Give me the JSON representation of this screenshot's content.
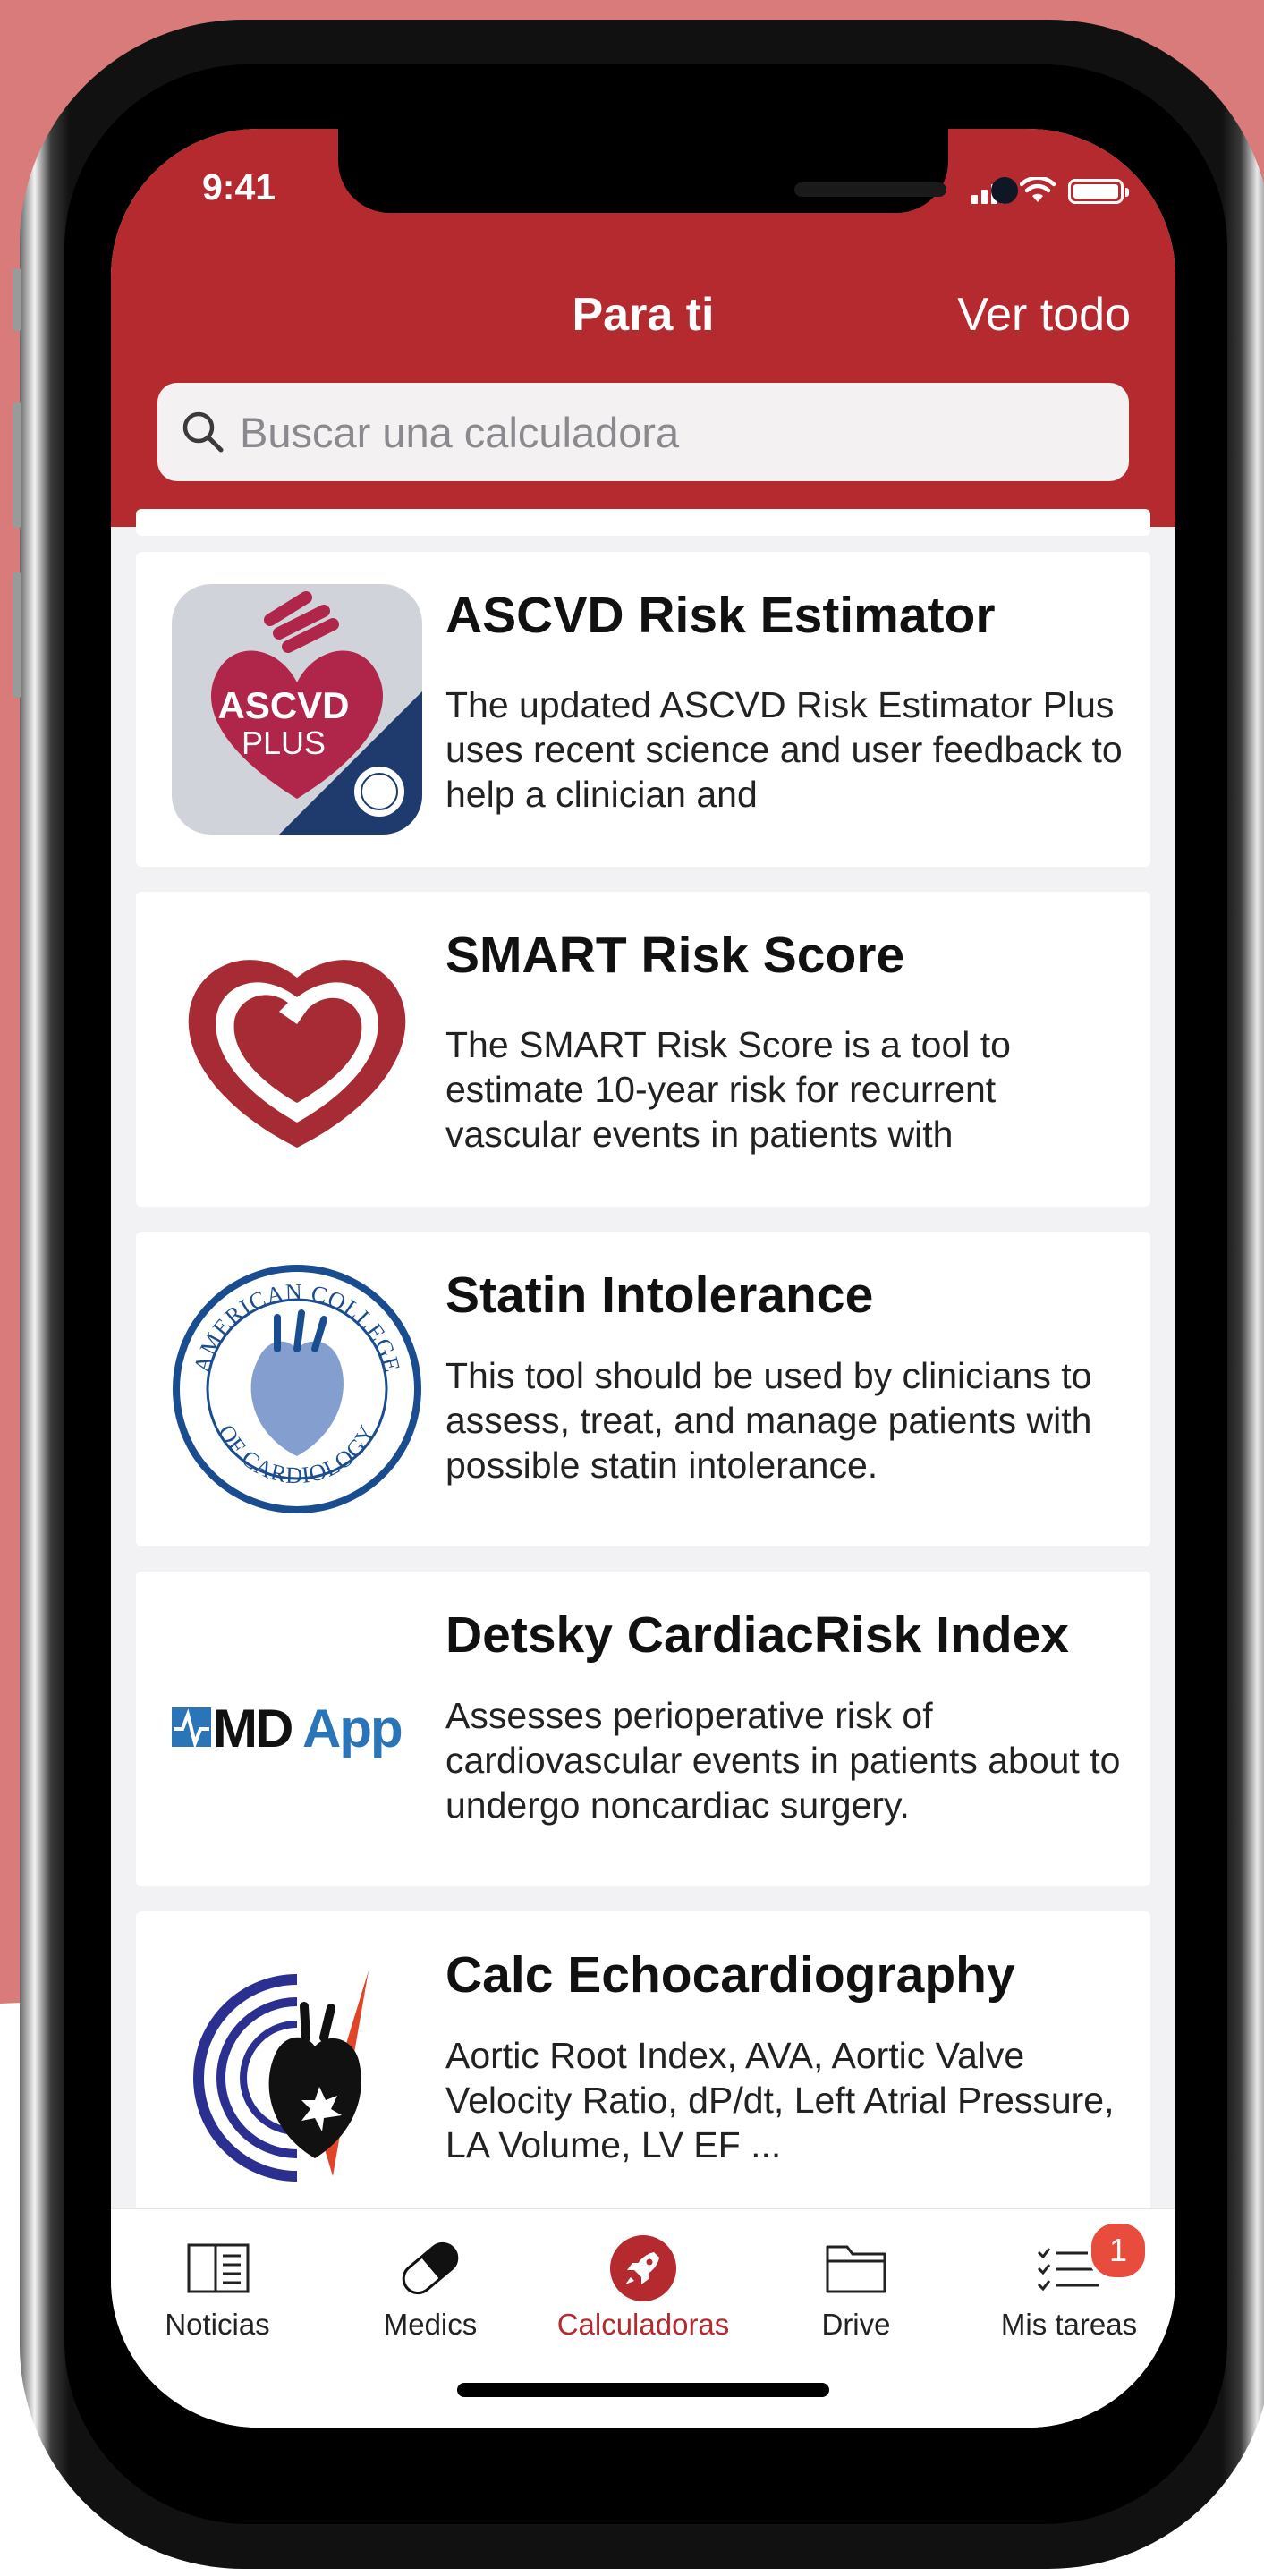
{
  "status_bar": {
    "time": "9:41"
  },
  "header": {
    "title": "Para ti",
    "action": "Ver todo"
  },
  "search": {
    "placeholder": "Buscar una calculadora"
  },
  "cards": [
    {
      "title": "ASCVD Risk Estimator",
      "description": "The updated ASCVD Risk Estimator Plus uses recent science and user feedback to help a clinician and",
      "icon": "ascvd-plus-logo",
      "icon_text": [
        "ASCVD",
        "PLUS"
      ]
    },
    {
      "title": "SMART Risk Score",
      "description": "The SMART Risk Score is a tool to estimate 10-year risk for recurrent vascular events in patients with",
      "icon": "heart-logo"
    },
    {
      "title": "Statin Intolerance",
      "description": "This tool should be used by clinicians to assess, treat, and manage patients with possible statin intolerance.",
      "icon": "acc-seal-logo",
      "icon_text": [
        "AMERICAN COLLEGE",
        "OF CARDIOLOGY"
      ]
    },
    {
      "title": "Detsky CardiacRisk Index",
      "description": "Assesses perioperative risk of cardiovascular events in patients about to undergo noncardiac surgery.",
      "icon": "mdapp-logo",
      "icon_text": [
        "MD",
        "App"
      ]
    },
    {
      "title": "Calc Echocardiography",
      "description": "Aortic Root Index, AVA, Aortic Valve Velocity Ratio, dP/dt, Left Atrial Pressure, LA Volume, LV EF ...",
      "icon": "echo-heart-logo"
    }
  ],
  "tabs": [
    {
      "label": "Noticias",
      "icon": "newspaper-icon"
    },
    {
      "label": "Medics",
      "icon": "pill-icon"
    },
    {
      "label": "Calculadoras",
      "icon": "rocket-icon",
      "active": true
    },
    {
      "label": "Drive",
      "icon": "folder-icon"
    },
    {
      "label": "Mis tareas",
      "icon": "checklist-icon",
      "badge": "1"
    }
  ],
  "colors": {
    "brand": "#b52a2f",
    "background": "#d97b7b",
    "badge": "#e74c3c"
  }
}
